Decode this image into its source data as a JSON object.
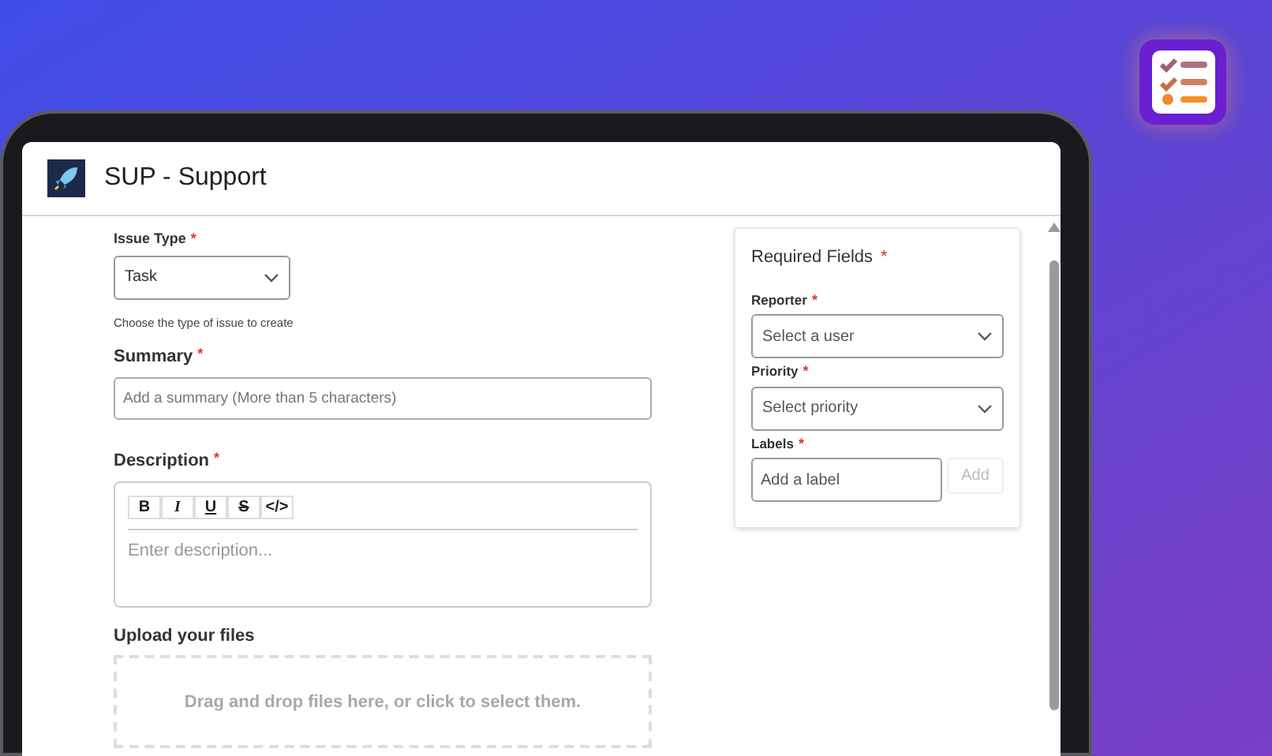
{
  "app": {
    "title": "SUP - Support"
  },
  "form": {
    "issue_type": {
      "label": "Issue Type",
      "mark": "*",
      "value": "Task",
      "hint": "Choose the type of issue to create"
    },
    "summary": {
      "label": "Summary",
      "mark": "*",
      "placeholder": "Add a summary (More than 5 characters)"
    },
    "description": {
      "label": "Description",
      "mark": "*",
      "toolbar": [
        "B",
        "I",
        "U",
        "S",
        "</>"
      ],
      "placeholder": "Enter description..."
    },
    "upload": {
      "label": "Upload your files",
      "dropzone_text": "Drag and drop files here, or click to select them."
    }
  },
  "required_fields": {
    "title": "Required Fields",
    "mark": "*",
    "fields": [
      {
        "kind": "select",
        "label": "Reporter",
        "mark": "*",
        "placeholder": "Select a user"
      },
      {
        "kind": "select",
        "label": "Priority",
        "mark": "*",
        "placeholder": "Select priority"
      },
      {
        "kind": "input",
        "label": "Labels",
        "mark": "*",
        "placeholder": "Add a label",
        "button": "Add"
      }
    ]
  }
}
